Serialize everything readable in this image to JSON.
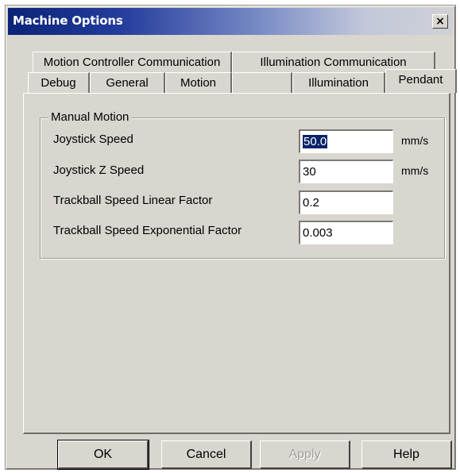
{
  "window": {
    "title": "Machine Options",
    "close_label": "×"
  },
  "tabs": {
    "top_row": [
      {
        "label": "Motion Controller Communication"
      },
      {
        "label": "Illumination Communication"
      }
    ],
    "bottom_row": [
      {
        "label": "Debug"
      },
      {
        "label": "General"
      },
      {
        "label": "Motion"
      },
      {
        "label": ""
      },
      {
        "label": "Illumination"
      },
      {
        "label": "Pendant",
        "active": true
      }
    ]
  },
  "group": {
    "label": "Manual Motion",
    "fields": [
      {
        "label": "Joystick Speed",
        "value": "50.0",
        "unit": "mm/s",
        "selected": true
      },
      {
        "label": "Joystick Z Speed",
        "value": "30",
        "unit": "mm/s"
      },
      {
        "label": "Trackball Speed Linear Factor",
        "value": "0.2",
        "unit": ""
      },
      {
        "label": "Trackball Speed Exponential Factor",
        "value": "0.003",
        "unit": ""
      }
    ]
  },
  "buttons": {
    "ok": "OK",
    "cancel": "Cancel",
    "apply": "Apply",
    "help": "Help"
  },
  "colors": {
    "title_start": "#0b2477",
    "title_end": "#d0d1d6",
    "face": "#d9d6cf",
    "selection": "#0a246a"
  }
}
